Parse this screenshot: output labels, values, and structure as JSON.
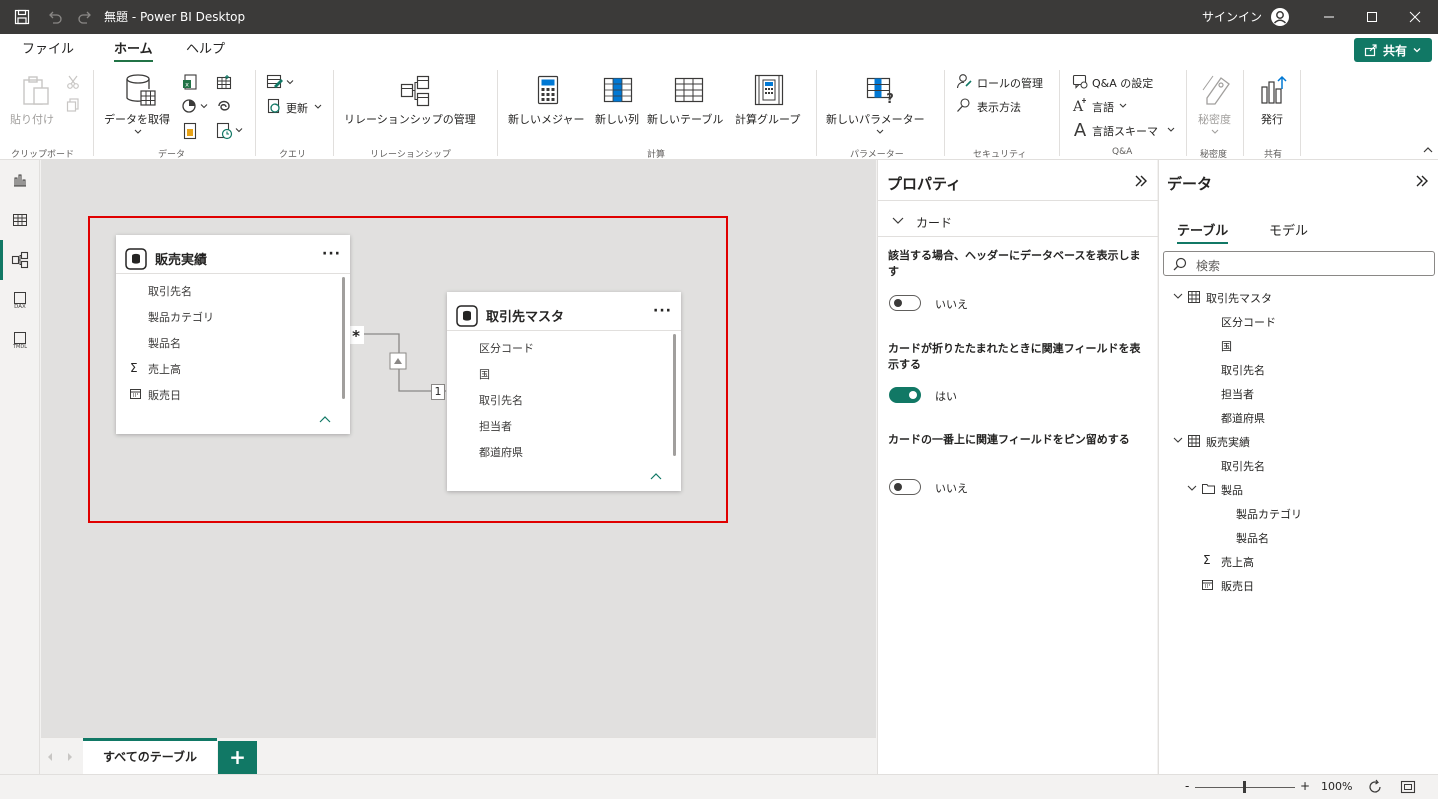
{
  "window": {
    "title": "無題 - Power BI Desktop",
    "signin": "サインイン"
  },
  "menu_tabs": [
    "ファイル",
    "ホーム",
    "ヘルプ"
  ],
  "share_label": "共有",
  "ribbon": {
    "paste": "貼り付け",
    "get_data": "データを取得",
    "refresh": "更新",
    "manage_relationships": "リレーションシップの管理",
    "new_measure": "新しいメジャー",
    "new_column": "新しい列",
    "new_table": "新しいテーブル",
    "calc_group": "計算グループ",
    "new_parameter": "新しいパラメーター",
    "manage_roles": "ロールの管理",
    "view_as": "表示方法",
    "qa_setup": "Q&A の設定",
    "language": "言語",
    "linguistic_schema": "言語スキーマ",
    "sensitivity": "秘密度",
    "publish": "発行",
    "groups": {
      "clipboard": "クリップボード",
      "data": "データ",
      "query": "クエリ",
      "relationships": "リレーションシップ",
      "calculations": "計算",
      "parameters": "パラメーター",
      "security": "セキュリティ",
      "qa": "Q&A",
      "sensitivity": "秘密度",
      "share": "共有"
    }
  },
  "model": {
    "sales_table": {
      "name": "販売実績",
      "fields": [
        "取引先名",
        "製品カテゴリ",
        "製品名",
        "売上高",
        "販売日"
      ]
    },
    "customer_table": {
      "name": "取引先マスタ",
      "fields": [
        "区分コード",
        "国",
        "取引先名",
        "担当者",
        "都道府県"
      ]
    },
    "relationship": {
      "many_symbol": "*",
      "one_symbol": "1"
    },
    "highlight_color": "#e00000"
  },
  "bottom_tabs": {
    "active": "すべてのテーブル",
    "add": "+"
  },
  "properties": {
    "title": "プロパティ",
    "section": "カード",
    "settings": [
      {
        "label": "該当する場合、ヘッダーにデータベースを表示します",
        "state": "いいえ",
        "on": false
      },
      {
        "label": "カードが折りたたまれたときに関連フィールドを表示する",
        "state": "はい",
        "on": true
      },
      {
        "label": "カードの一番上に関連フィールドをピン留めする",
        "state": "いいえ",
        "on": false
      }
    ]
  },
  "data_pane": {
    "title": "データ",
    "tabs": [
      "テーブル",
      "モデル"
    ],
    "search_placeholder": "検索",
    "tree": {
      "customer_table": "取引先マスタ",
      "customer_fields": [
        "区分コード",
        "国",
        "取引先名",
        "担当者",
        "都道府県"
      ],
      "sales_table": "販売実績",
      "sales_field_1": "取引先名",
      "folder": "製品",
      "folder_fields": [
        "製品カテゴリ",
        "製品名"
      ],
      "sum_field": "売上高",
      "date_field": "販売日"
    }
  },
  "status": {
    "zoom": "100%",
    "minus": "-",
    "plus": "+"
  }
}
